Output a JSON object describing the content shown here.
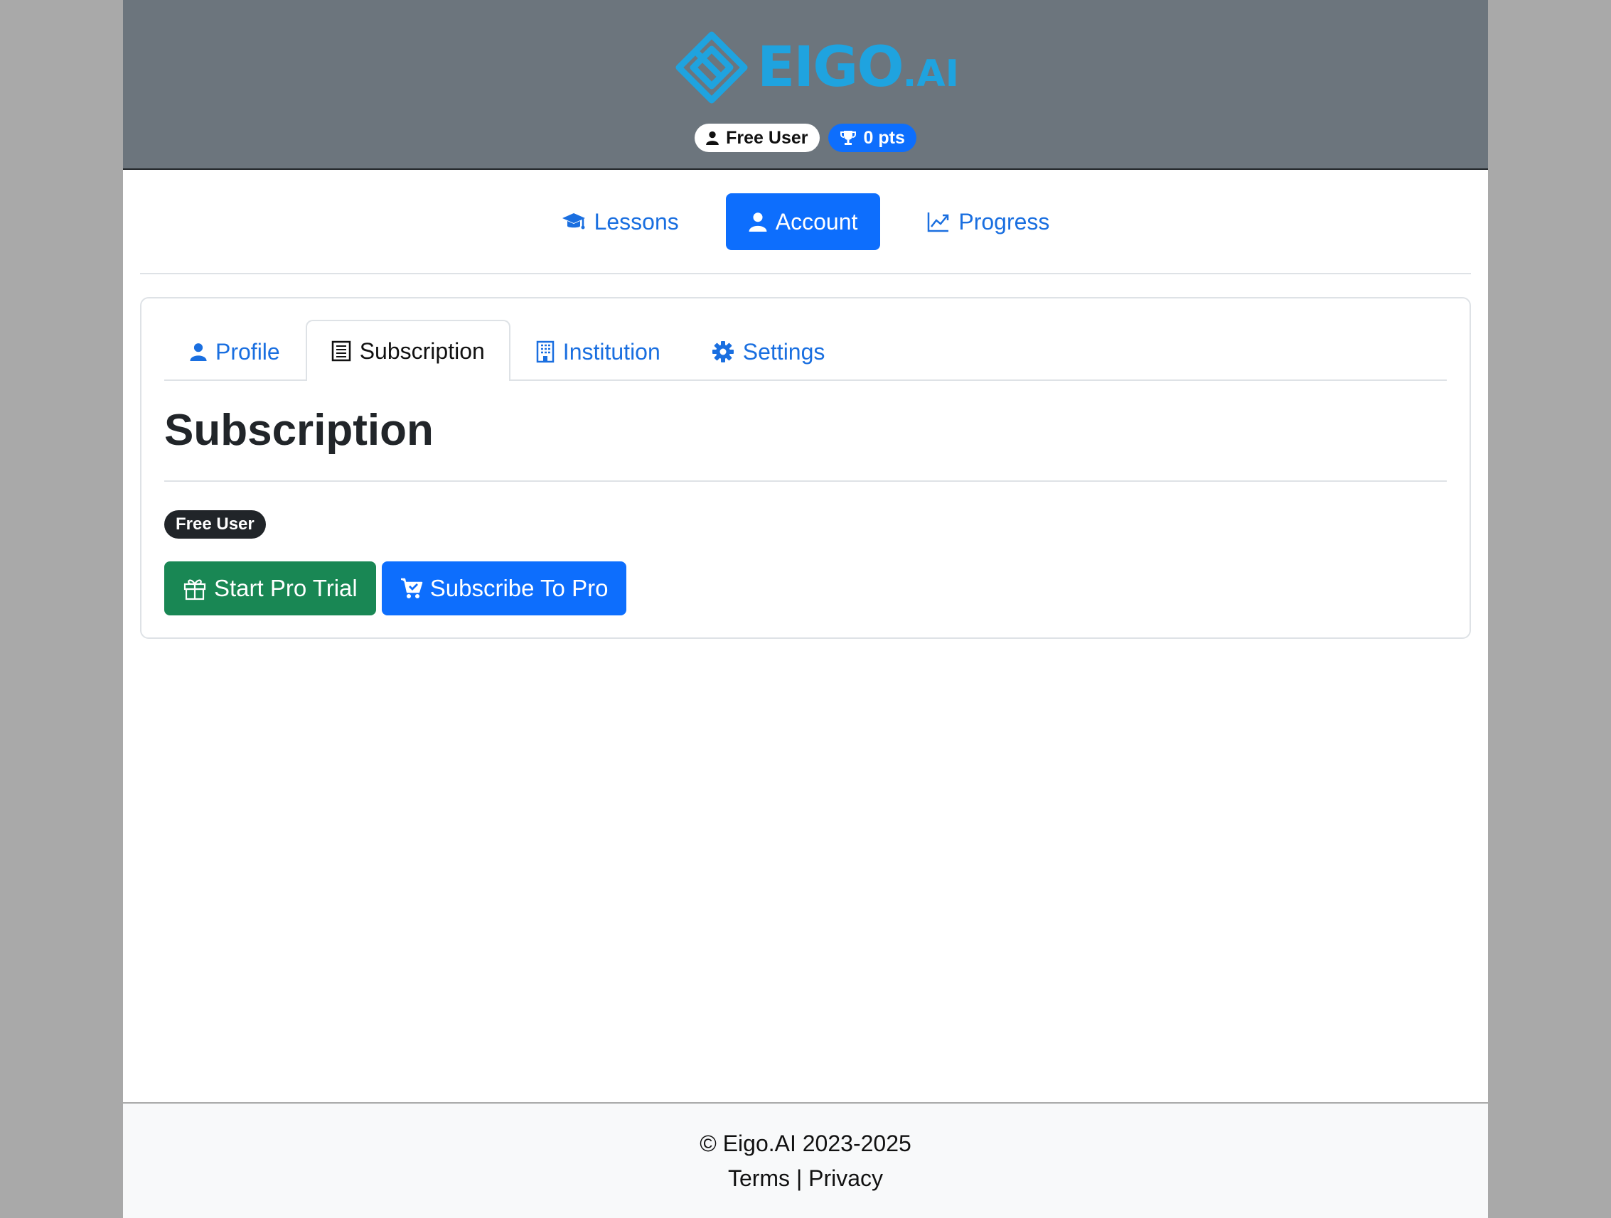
{
  "header": {
    "logo_text": "EIGO",
    "logo_suffix": ".AI",
    "user_badge": "Free User",
    "points_badge": "0 pts"
  },
  "nav": {
    "items": [
      {
        "label": "Lessons",
        "icon": "graduation-cap-icon"
      },
      {
        "label": "Account",
        "icon": "user-icon",
        "active": true
      },
      {
        "label": "Progress",
        "icon": "chart-line-icon"
      }
    ]
  },
  "tabs": {
    "items": [
      {
        "label": "Profile",
        "icon": "user-icon"
      },
      {
        "label": "Subscription",
        "icon": "receipt-icon",
        "active": true
      },
      {
        "label": "Institution",
        "icon": "building-icon"
      },
      {
        "label": "Settings",
        "icon": "gear-icon"
      }
    ]
  },
  "subscription": {
    "title": "Subscription",
    "status": "Free User",
    "trial_button": "Start Pro Trial",
    "subscribe_button": "Subscribe To Pro"
  },
  "footer": {
    "copyright": "© Eigo.AI 2023-2025",
    "terms": "Terms",
    "separator": "|",
    "privacy": "Privacy"
  },
  "colors": {
    "header_bg": "#6c757d",
    "primary": "#0d6efd",
    "success": "#198754",
    "logo": "#1fa3df"
  }
}
